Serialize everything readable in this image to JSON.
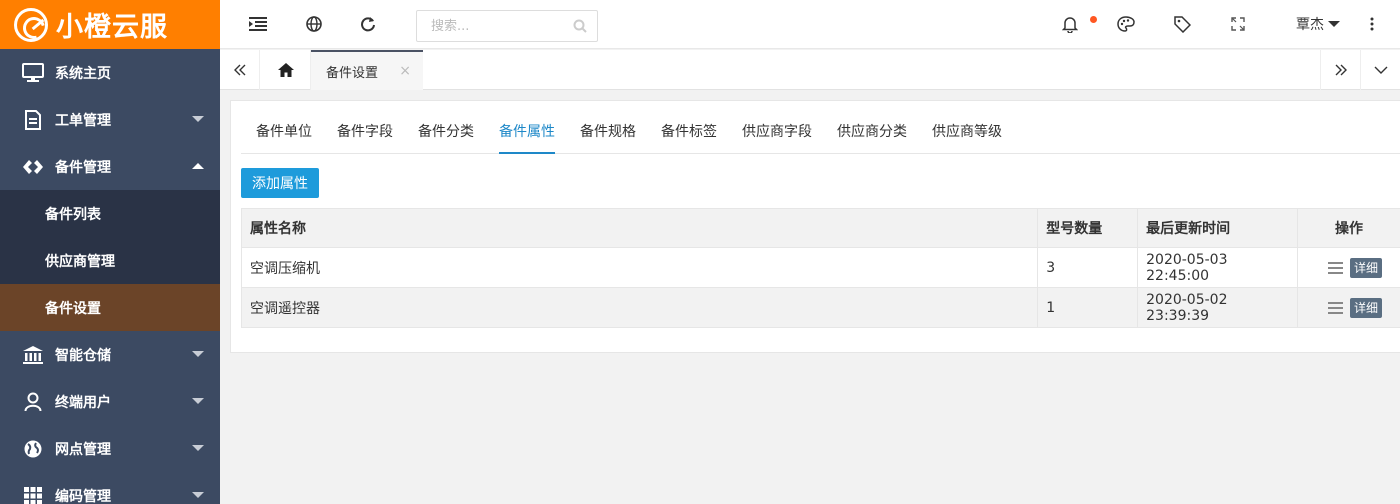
{
  "brand": {
    "name": "小橙云服"
  },
  "sidebar": {
    "items": [
      {
        "label": "系统主页",
        "icon": "monitor-icon"
      },
      {
        "label": "工单管理",
        "icon": "document-icon"
      },
      {
        "label": "备件管理",
        "icon": "diamond-link-icon"
      },
      {
        "label": "智能仓储",
        "icon": "bank-icon"
      },
      {
        "label": "终端用户",
        "icon": "user-icon"
      },
      {
        "label": "网点管理",
        "icon": "globe-icon"
      },
      {
        "label": "编码管理",
        "icon": "grid-icon"
      }
    ],
    "submenu": [
      {
        "label": "备件列表"
      },
      {
        "label": "供应商管理"
      },
      {
        "label": "备件设置",
        "active": true
      }
    ]
  },
  "header": {
    "search_placeholder": "搜索...",
    "user_name": "覃杰"
  },
  "tabbar": {
    "current_tab": "备件设置",
    "close_glyph": "×"
  },
  "content": {
    "subtabs": [
      "备件单位",
      "备件字段",
      "备件分类",
      "备件属性",
      "备件规格",
      "备件标签",
      "供应商字段",
      "供应商分类",
      "供应商等级"
    ],
    "active_subtab": "备件属性",
    "add_button": "添加属性",
    "table": {
      "headers": [
        "属性名称",
        "型号数量",
        "最后更新时间",
        "操作"
      ],
      "rows": [
        {
          "name": "空调压缩机",
          "count": "3",
          "updated": "2020-05-03 22:45:00",
          "action": "详细"
        },
        {
          "name": "空调遥控器",
          "count": "1",
          "updated": "2020-05-02 23:39:39",
          "action": "详细"
        }
      ]
    }
  },
  "colors": {
    "brand": "#ff7f00",
    "sidebar": "#3c4a62",
    "active_sub": "#6b4428",
    "accent": "#1e9bdb"
  }
}
